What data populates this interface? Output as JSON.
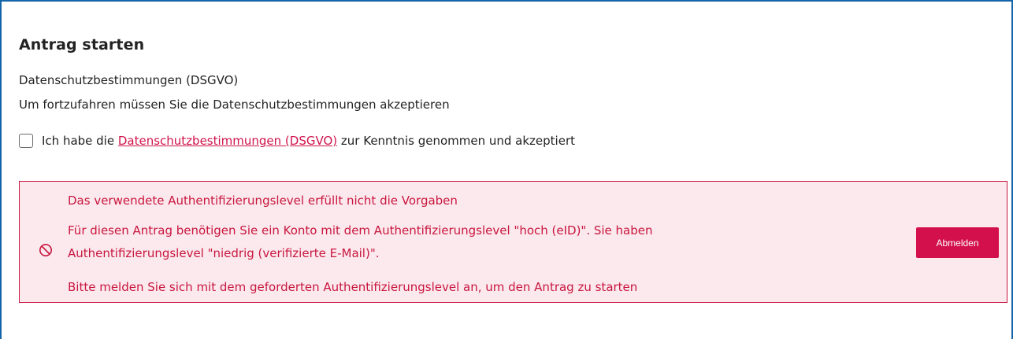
{
  "form": {
    "title": "Antrag starten",
    "privacy_title": "Datenschutzbestimmungen (DSGVO)",
    "privacy_hint": "Um fortzufahren müssen Sie die Datenschutzbestimmungen akzeptieren",
    "consent": {
      "checked": false,
      "prefix": "Ich habe die ",
      "link_text": "Datenschutzbestimmungen (DSGVO)",
      "suffix": " zur Kenntnis genommen und akzeptiert"
    }
  },
  "alert": {
    "icon": "prohibited-icon",
    "title": "Das verwendete Authentifizierungslevel erfüllt nicht die Vorgaben",
    "message_line_1": "Für diesen Antrag benötigen Sie ein Konto mit dem Authentifizierungslevel \"hoch (eID)\". Sie haben",
    "message_line_2": "Authentifizierungslevel \"niedrig (verifizierte E-Mail)\".",
    "instruction": "Bitte melden Sie sich mit dem geforderten Authentifizierungslevel an, um den Antrag zu starten",
    "button_label": "Abmelden"
  },
  "colors": {
    "frame_border": "#1565a8",
    "error_text": "#c9163f",
    "error_background": "#fbe9ed",
    "button_background": "#d3104b",
    "link": "#d0144a"
  }
}
